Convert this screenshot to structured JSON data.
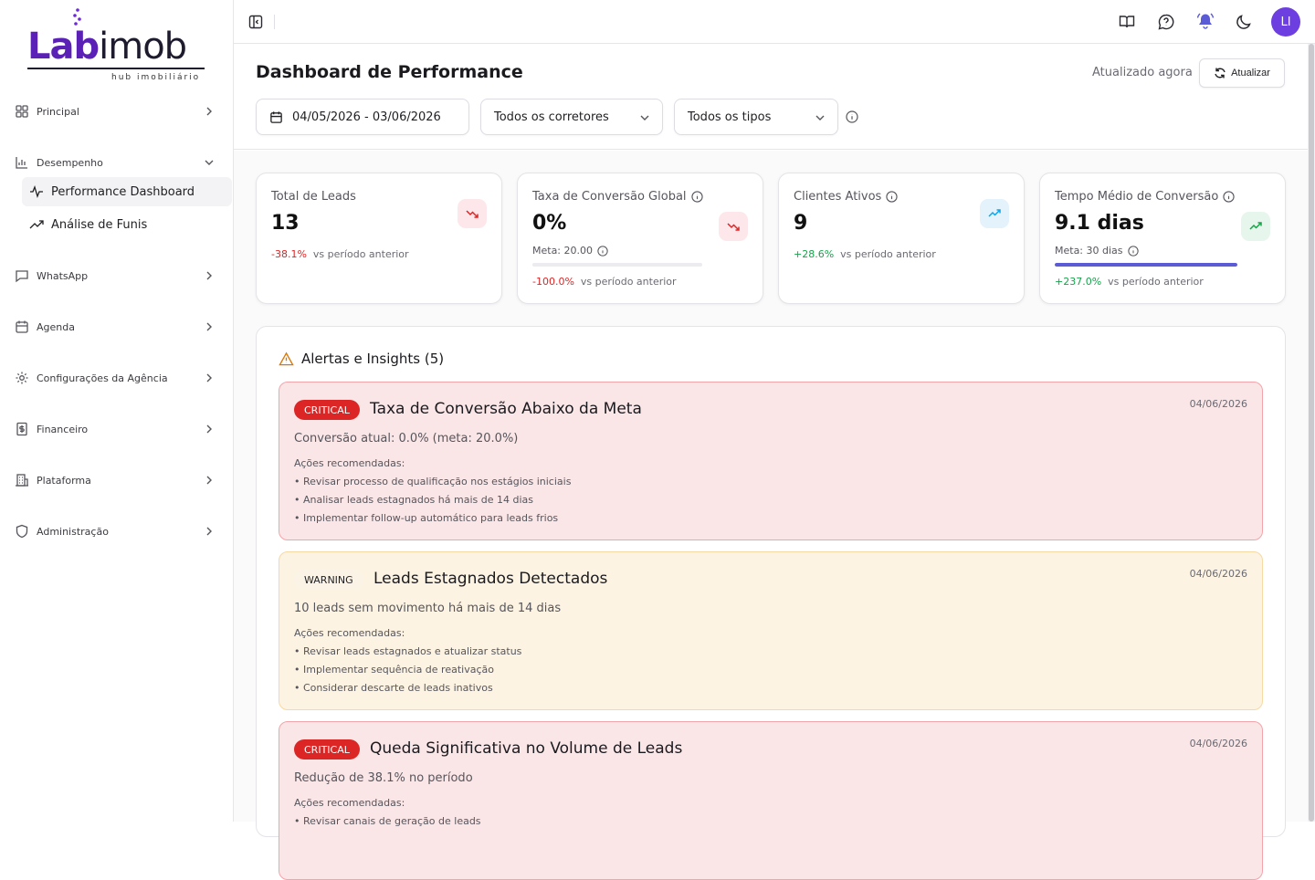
{
  "app": {
    "logo_main_a": "Lab",
    "logo_main_b": "imob",
    "logo_sub": "hub imobiliário"
  },
  "sidebar": {
    "items": [
      {
        "label": "Principal",
        "icon": "grid-icon"
      },
      {
        "label": "Desempenho",
        "icon": "bar-chart-icon"
      },
      {
        "label": "WhatsApp",
        "icon": "message-icon"
      },
      {
        "label": "Agenda",
        "icon": "calendar-icon"
      },
      {
        "label": "Configurações da Agência",
        "icon": "gear-icon"
      },
      {
        "label": "Financeiro",
        "icon": "receipt-icon"
      },
      {
        "label": "Plataforma",
        "icon": "building-icon"
      },
      {
        "label": "Administração",
        "icon": "shield-icon"
      }
    ],
    "subitems": [
      {
        "label": "Performance Dashboard",
        "icon": "activity-icon",
        "active": true
      },
      {
        "label": "Análise de Funis",
        "icon": "trend-icon",
        "active": false
      }
    ]
  },
  "topbar": {
    "avatar_initials": "LI",
    "icons": [
      "sidebar-toggle-icon",
      "book-icon",
      "help-chat-icon",
      "bell-icon",
      "moon-icon"
    ]
  },
  "header": {
    "title": "Dashboard de Performance",
    "updated": "Atualizado agora",
    "refresh_label": "Atualizar",
    "filters": {
      "date_range": "04/05/2026 - 03/06/2026",
      "brokers": "Todos os corretores",
      "types": "Todos os tipos"
    }
  },
  "kpis": [
    {
      "label": "Total de Leads",
      "value": "13",
      "delta": "-38.1%",
      "delta_suffix": "vs período anterior",
      "trend": "down",
      "color": "#dc2626"
    },
    {
      "label": "Taxa de Conversão Global",
      "value": "0%",
      "meta": "Meta: 20.00",
      "progress": 0,
      "delta": "-100.0%",
      "delta_suffix": "vs período anterior",
      "trend": "down",
      "color": "#dc2626"
    },
    {
      "label": "Clientes Ativos",
      "value": "9",
      "delta": "+28.6%",
      "delta_suffix": "vs período anterior",
      "trend": "up",
      "color": "#0ea5e9"
    },
    {
      "label": "Tempo Médio de Conversão",
      "value": "9.1 dias",
      "meta": "Meta: 30 dias",
      "progress": 1.0,
      "delta": "+237.0%",
      "delta_suffix": "vs período anterior",
      "trend": "up",
      "color": "#16a34a"
    }
  ],
  "alerts": {
    "title": "Alertas e Insights (5)",
    "actions_label": "Ações recomendadas:",
    "items": [
      {
        "severity": "CRITICAL",
        "title": "Taxa de Conversão Abaixo da Meta",
        "date": "04/06/2026",
        "description": "Conversão atual: 0.0% (meta: 20.0%)",
        "actions": [
          "• Revisar processo de qualificação nos estágios iniciais",
          "• Analisar leads estagnados há mais de 14 dias",
          "• Implementar follow-up automático para leads frios"
        ]
      },
      {
        "severity": "WARNING",
        "title": "Leads Estagnados Detectados",
        "date": "04/06/2026",
        "description": "10 leads sem movimento há mais de 14 dias",
        "actions": [
          "• Revisar leads estagnados e atualizar status",
          "• Implementar sequência de reativação",
          "• Considerar descarte de leads inativos"
        ]
      },
      {
        "severity": "CRITICAL",
        "title": "Queda Significativa no Volume de Leads",
        "date": "04/06/2026",
        "description": "Redução de 38.1% no período",
        "actions": [
          "• Revisar canais de geração de leads"
        ]
      }
    ]
  }
}
